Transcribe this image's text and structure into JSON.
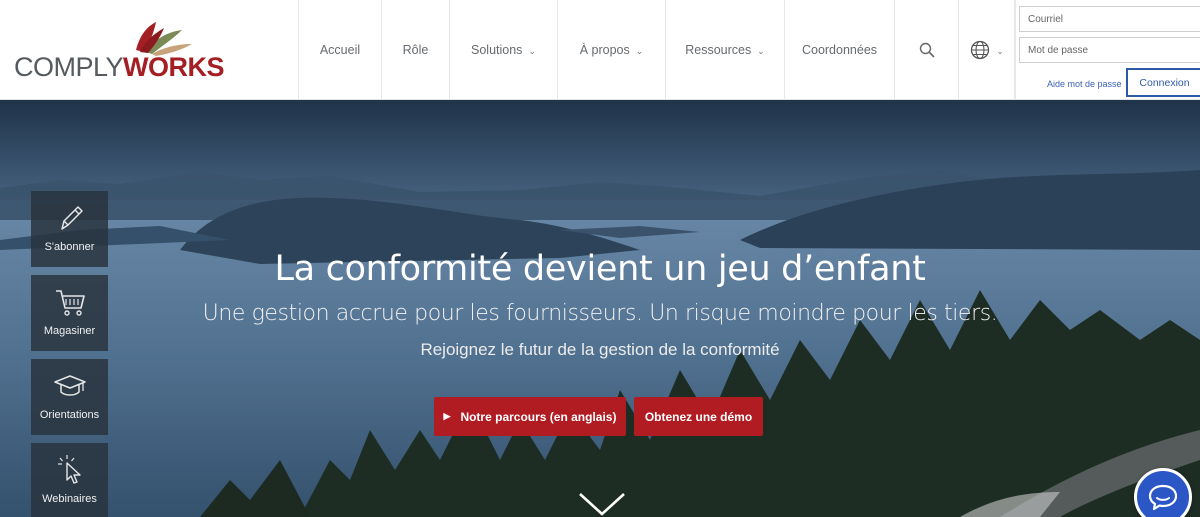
{
  "header": {
    "logo": {
      "comply": "COMPLY",
      "works": "WORKS"
    },
    "nav": [
      {
        "label": "Accueil",
        "has_dropdown": false
      },
      {
        "label": "Rôle",
        "has_dropdown": false
      },
      {
        "label": "Solutions",
        "has_dropdown": true
      },
      {
        "label": "À propos",
        "has_dropdown": true
      },
      {
        "label": "Ressources",
        "has_dropdown": true
      },
      {
        "label": "Coordonnées",
        "has_dropdown": false
      }
    ],
    "icons": {
      "search": "search-icon",
      "language": "globe-icon"
    },
    "login": {
      "email_placeholder": "Courriel",
      "password_placeholder": "Mot de passe",
      "forgot_link": "Aide mot de passe",
      "submit_label": "Connexion"
    }
  },
  "sidebar": [
    {
      "label": "S'abonner",
      "icon": "pencil-icon"
    },
    {
      "label": "Magasiner",
      "icon": "cart-icon"
    },
    {
      "label": "Orientations",
      "icon": "graduation-cap-icon"
    },
    {
      "label": "Webinaires",
      "icon": "pointer-click-icon"
    }
  ],
  "hero": {
    "title": "La conformité devient un jeu d’enfant",
    "subtitle": "Une gestion accrue pour les fournisseurs. Un risque moindre pour les tiers.",
    "tagline": "Rejoignez le futur de la gestion de la conformité",
    "cta_primary": "Notre parcours (en anglais)",
    "cta_secondary": "Obtenez une démo"
  },
  "colors": {
    "brand_red": "#a31f24",
    "cta_red": "#b11c22",
    "link_blue": "#3d62b5",
    "chat_blue": "#2a56c6"
  }
}
